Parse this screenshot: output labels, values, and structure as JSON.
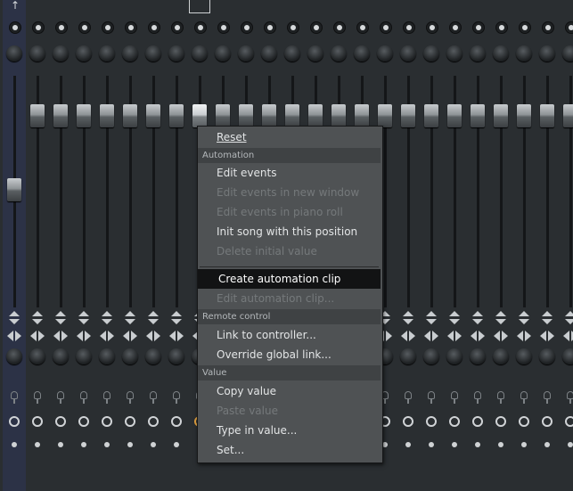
{
  "mixer": {
    "strip_count": 25,
    "selected_strip": 0,
    "highlighted_fader_strip": 8
  },
  "context_menu": {
    "items": [
      {
        "type": "item",
        "label": "Reset",
        "enabled": true
      },
      {
        "type": "header",
        "label": "Automation"
      },
      {
        "type": "item",
        "label": "Edit events",
        "enabled": true
      },
      {
        "type": "item",
        "label": "Edit events in new window",
        "enabled": false
      },
      {
        "type": "item",
        "label": "Edit events in piano roll",
        "enabled": false
      },
      {
        "type": "item",
        "label": "Init song with this position",
        "enabled": true
      },
      {
        "type": "item",
        "label": "Delete initial value",
        "enabled": false
      },
      {
        "type": "separator"
      },
      {
        "type": "item",
        "label": "Create automation clip",
        "enabled": true,
        "highlighted": true
      },
      {
        "type": "item",
        "label": "Edit automation clip...",
        "enabled": false
      },
      {
        "type": "header",
        "label": "Remote control"
      },
      {
        "type": "item",
        "label": "Link to controller...",
        "enabled": true
      },
      {
        "type": "item",
        "label": "Override global link...",
        "enabled": true
      },
      {
        "type": "header",
        "label": "Value"
      },
      {
        "type": "item",
        "label": "Copy value",
        "enabled": true
      },
      {
        "type": "item",
        "label": "Paste value",
        "enabled": false
      },
      {
        "type": "item",
        "label": "Type in value...",
        "enabled": true
      },
      {
        "type": "item",
        "label": "Set...",
        "enabled": true
      }
    ]
  },
  "colors": {
    "background": "#2a2e31",
    "selected_strip": "#2c3246",
    "menu_background": "#4f5254",
    "menu_highlight": "#121314",
    "menu_header": "#3f4244",
    "accent_orange": "#e0a040"
  }
}
